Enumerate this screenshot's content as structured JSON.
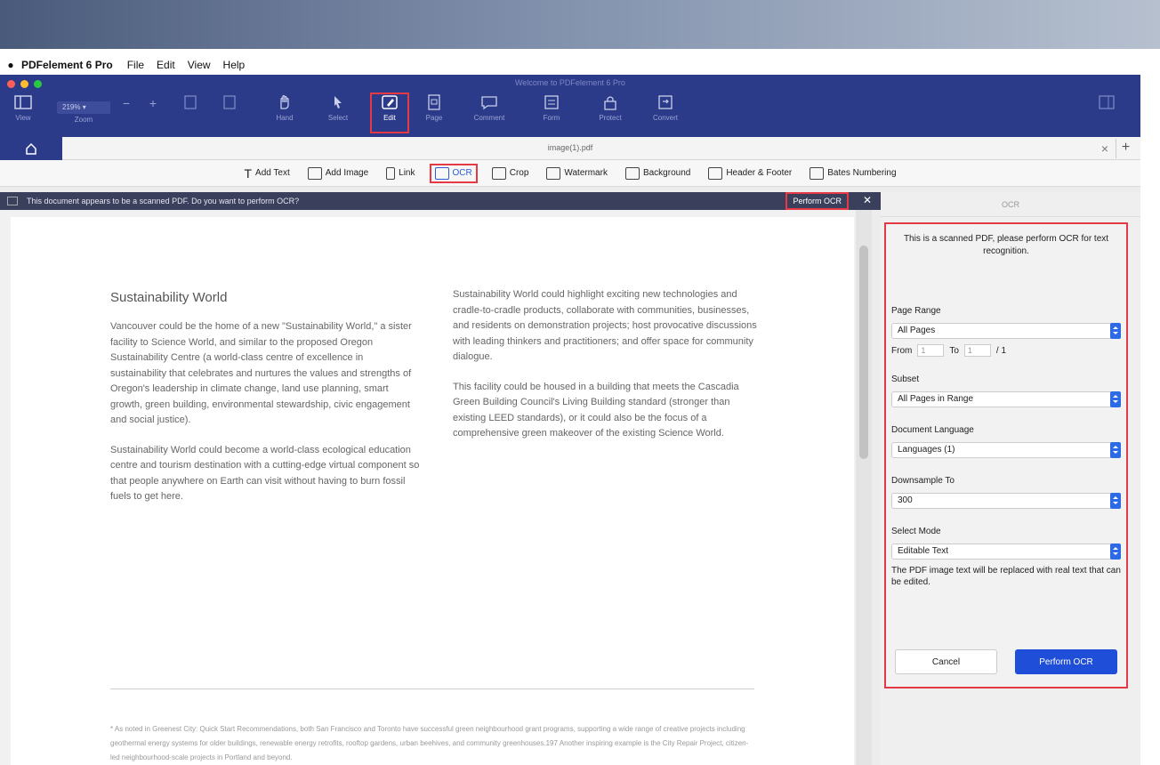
{
  "menubar": {
    "app_name": "PDFelement 6 Pro",
    "items": [
      "File",
      "Edit",
      "View",
      "Help"
    ]
  },
  "window": {
    "title": "Welcome to PDFelement 6 Pro",
    "zoom_value": "219%"
  },
  "toolbar": {
    "tools": [
      {
        "label": "View",
        "icon": "sidebar-icon"
      },
      {
        "label": "Zoom",
        "icon": "zoom-icon"
      },
      {
        "label": "Hand",
        "icon": "hand-icon"
      },
      {
        "label": "Select",
        "icon": "cursor-icon"
      },
      {
        "label": "Edit",
        "icon": "edit-icon"
      },
      {
        "label": "Page",
        "icon": "page-icon"
      },
      {
        "label": "Comment",
        "icon": "comment-icon"
      },
      {
        "label": "Form",
        "icon": "form-icon"
      },
      {
        "label": "Protect",
        "icon": "lock-icon"
      },
      {
        "label": "Convert",
        "icon": "convert-icon"
      }
    ],
    "active_tool": "Edit",
    "accent": "#2c3a8a",
    "highlight": "#e63946"
  },
  "tabbar": {
    "file_name": "image(1).pdf"
  },
  "edit_toolbar": {
    "items": [
      "Add Text",
      "Add Image",
      "Link",
      "OCR",
      "Crop",
      "Watermark",
      "Background",
      "Header & Footer",
      "Bates Numbering"
    ],
    "active": "OCR"
  },
  "notification": {
    "message": "This document appears to be a scanned PDF. Do you want to perform OCR?",
    "action_label": "Perform OCR"
  },
  "document": {
    "title": "Sustainability World",
    "left_paragraphs": [
      "Vancouver could be the home of a new \"Sustainability World,\" a sister facility to Science World, and similar to the proposed Oregon Sustainability Centre (a world-class centre of excellence in sustainability that celebrates and nurtures the values and strengths of Oregon's leadership in climate change, land use planning, smart growth, green building, environmental stewardship, civic engagement and social justice).",
      "Sustainability World could become a world-class ecological education centre and tourism destination with a cutting-edge virtual component so that people anywhere on Earth can visit without having to burn fossil fuels to get here."
    ],
    "right_paragraphs": [
      "Sustainability World could highlight exciting new technologies and cradle-to-cradle products, collaborate with communities, businesses, and residents on demonstration projects; host provocative discussions with leading thinkers and practitioners; and offer space for community dialogue.",
      "This facility could be housed in a building that meets the Cascadia Green Building Council's Living Building standard (stronger than existing LEED standards), or it could also be the focus of a comprehensive green makeover of the existing Science World."
    ],
    "footnote": "* As noted in Greenest City: Quick Start Recommendations, both San Francisco and Toronto have successful green neighbourhood grant programs, supporting a wide range of creative projects including geothermal energy systems for older buildings, renewable energy retrofits, rooftop gardens, urban beehives, and community greenhouses.197 Another inspiring example is the City Repair Project, citizen-led neighbourhood-scale projects in Portland and beyond."
  },
  "ocr_panel": {
    "header": "OCR",
    "intro": "This is a scanned PDF, please perform OCR for text recognition.",
    "page_range_label": "Page Range",
    "page_range_value": "All Pages",
    "from_label": "From",
    "to_label": "To",
    "of_label": "/ 1",
    "subset_label": "Subset",
    "subset_value": "All Pages in Range",
    "language_label": "Document Language",
    "language_value": "Languages (1)",
    "downsample_label": "Downsample To",
    "downsample_value": "300",
    "mode_label": "Select Mode",
    "mode_value": "Editable Text",
    "mode_description": "The PDF image text will be replaced with real text that can be edited.",
    "cancel_label": "Cancel",
    "perform_label": "Perform OCR"
  }
}
